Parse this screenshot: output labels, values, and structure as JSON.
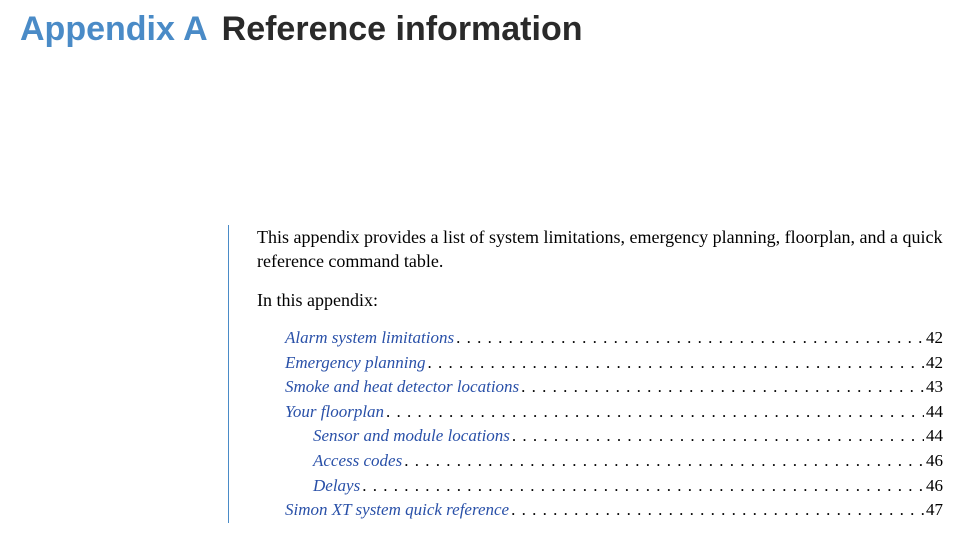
{
  "header": {
    "appendix_label": "Appendix A",
    "title": "Reference information"
  },
  "intro": {
    "paragraph": "This appendix provides a list of system limitations, emergency planning, floorplan, and a quick reference command table.",
    "lead_in": "In this appendix:"
  },
  "toc": [
    {
      "title": "Alarm system limitations",
      "page": "42",
      "level": 0
    },
    {
      "title": "Emergency planning",
      "page": "42",
      "level": 0
    },
    {
      "title": "Smoke and heat detector locations",
      "page": "43",
      "level": 0
    },
    {
      "title": "Your floorplan",
      "page": "44",
      "level": 0
    },
    {
      "title": "Sensor and module locations",
      "page": "44",
      "level": 1
    },
    {
      "title": "Access codes",
      "page": "46",
      "level": 1
    },
    {
      "title": "Delays",
      "page": "46",
      "level": 1
    },
    {
      "title": "Simon XT system quick reference",
      "page": "47",
      "level": 0
    }
  ]
}
